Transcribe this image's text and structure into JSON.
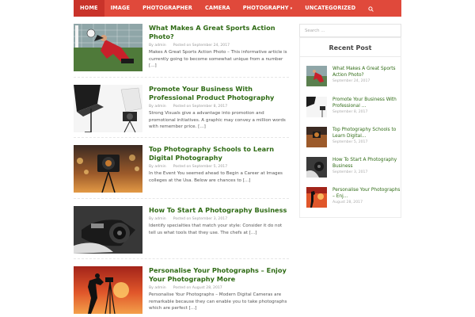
{
  "nav": {
    "items": [
      "HOME",
      "IMAGE",
      "PHOTOGRAPHER",
      "CAMERA",
      "PHOTOGRAPHY",
      "UNCATEGORIZED"
    ],
    "caret": "▾"
  },
  "posts": [
    {
      "title": "What Makes A Great Sports Action Photo?",
      "author": "By admin",
      "date": "Posted on September 24, 2017",
      "excerpt": "Makes A Great Sports Action Photo – This informative article is currently going to become somewhat unique from a number [...]"
    },
    {
      "title": "Promote Your Business With Professional Product Photography",
      "author": "By admin",
      "date": "Posted on September 8, 2017",
      "excerpt": "Strong Visuals give a advantage into promotion and promotional initiatives. A graphic may convey a million words with remember price. [...]"
    },
    {
      "title": "Top Photography Schools to Learn Digital Photography",
      "author": "By admin",
      "date": "Posted on September 5, 2017",
      "excerpt": "In the Event You seemed ahead to Begin a Career at Images colleges at the Usa. Below are chances to [...]"
    },
    {
      "title": "How To Start A Photography Business",
      "author": "By admin",
      "date": "Posted on September 3, 2017",
      "excerpt": "Identify specialties that match your style: Consider it do not tell us what tools that they use. The chefs at [...]"
    },
    {
      "title": "Personalise Your Photographs – Enjoy Your Photography More",
      "author": "By admin",
      "date": "Posted on August 28, 2017",
      "excerpt": "Personalise Your Photographs – Modern Digital Cameras are remarkable because they can enable you to take photographs which are perfect [...]"
    }
  ],
  "sidebar": {
    "search_placeholder": "Search ...",
    "recent_title": "Recent Post",
    "recent": [
      {
        "title": "What Makes A Great Sports Action Photo?",
        "date": "September 24, 2017"
      },
      {
        "title": "Promote Your Business With Professional ...",
        "date": "September 8, 2017"
      },
      {
        "title": "Top Photography Schools to Learn Digital...",
        "date": "September 5, 2017"
      },
      {
        "title": "How To Start A Photography Business",
        "date": "September 3, 2017"
      },
      {
        "title": "Personalise Your Photographs – Enj...",
        "date": "August 28, 2017"
      }
    ]
  },
  "colors": {
    "nav_bg": "#e0493b",
    "nav_active": "#c9332a",
    "title_green": "#2f6b15"
  },
  "icons": {
    "search": "search-icon"
  }
}
